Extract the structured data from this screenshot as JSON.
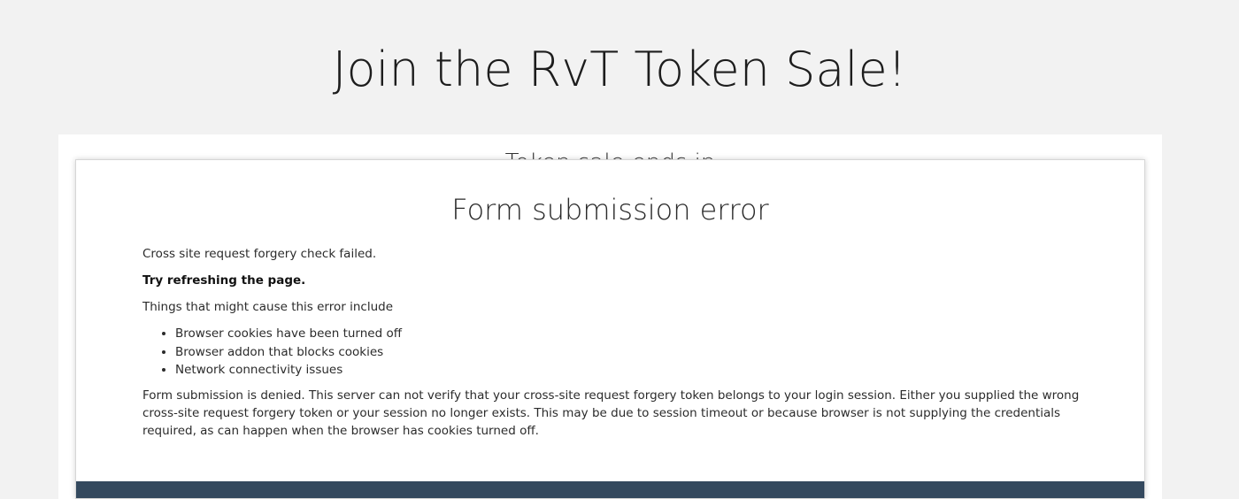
{
  "page": {
    "heading": "Join the RvT Token Sale!",
    "backdrop_text": "Token sale ends in"
  },
  "modal": {
    "title": "Form submission error",
    "message": "Cross site request forgery check failed.",
    "hint": "Try refreshing the page.",
    "causes_intro": "Things that might cause this error include",
    "causes": [
      "Browser cookies have been turned off",
      "Browser addon that blocks cookies",
      "Network connectivity issues"
    ],
    "details": "Form submission is denied. This server can not verify that your cross-site request forgery token belongs to your login session. Either you supplied the wrong cross-site request forgery token or your session no longer exists. This may be due to session timeout or because browser is not supplying the credentials required, as can happen when the browser has cookies turned off."
  },
  "colors": {
    "page_background": "#f2f2f2",
    "card_background": "#ffffff",
    "footer_bar": "#34495e"
  }
}
